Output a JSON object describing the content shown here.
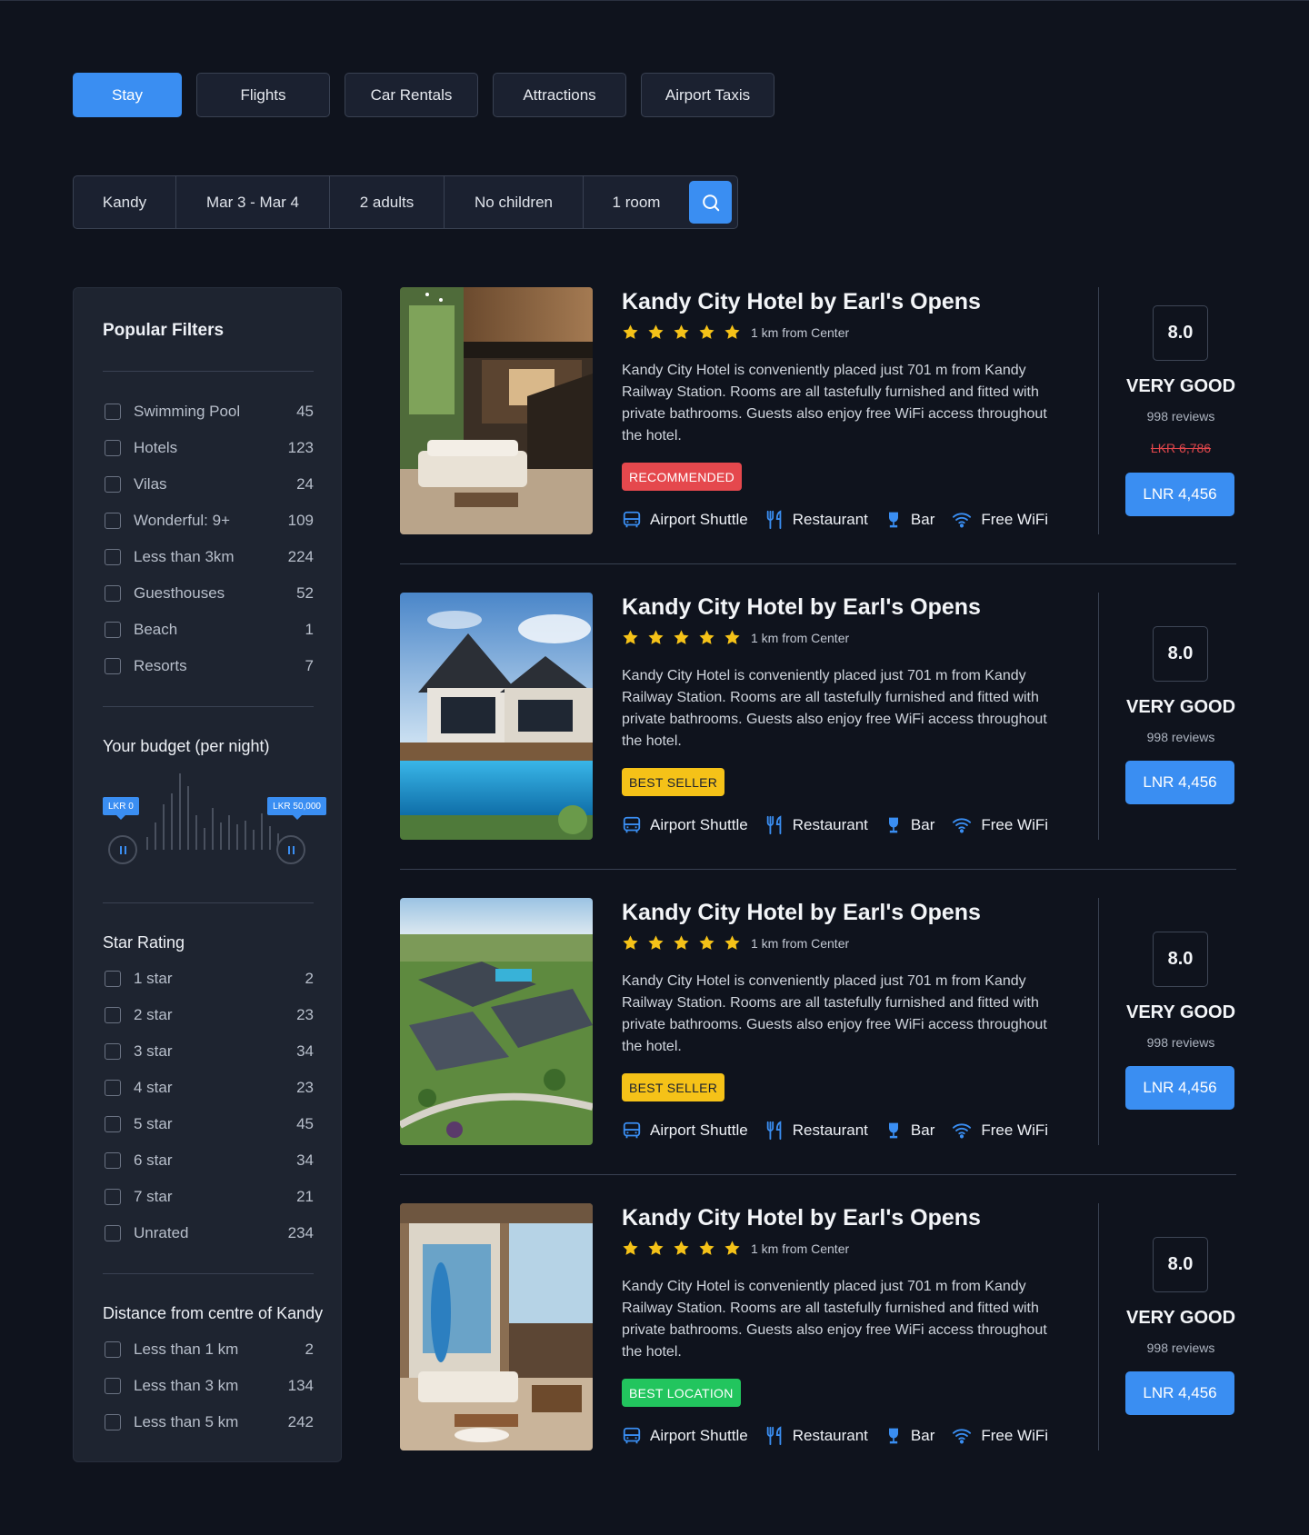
{
  "tabs": [
    "Stay",
    "Flights",
    "Car Rentals",
    "Attractions",
    "Airport Taxis"
  ],
  "active_tab": "Stay",
  "search": {
    "location": "Kandy",
    "dates": "Mar 3 - Mar 4",
    "adults": "2 adults",
    "children": "No children",
    "rooms": "1 room",
    "icon": "search-icon"
  },
  "sidebar": {
    "popular_title": "Popular Filters",
    "popular": [
      {
        "label": "Swimming Pool",
        "count": "45"
      },
      {
        "label": "Hotels",
        "count": "123"
      },
      {
        "label": "Vilas",
        "count": "24"
      },
      {
        "label": "Wonderful: 9+",
        "count": "109"
      },
      {
        "label": "Less than 3km",
        "count": "224"
      },
      {
        "label": "Guesthouses",
        "count": "52"
      },
      {
        "label": "Beach",
        "count": "1"
      },
      {
        "label": "Resorts",
        "count": "7"
      }
    ],
    "budget_title": "Your budget (per night)",
    "budget_min": "LKR 0",
    "budget_max": "LKR 50,000",
    "star_title": "Star Rating",
    "stars": [
      {
        "label": "1 star",
        "count": "2"
      },
      {
        "label": "2 star",
        "count": "23"
      },
      {
        "label": "3 star",
        "count": "34"
      },
      {
        "label": "4 star",
        "count": "23"
      },
      {
        "label": "5 star",
        "count": "45"
      },
      {
        "label": "6 star",
        "count": "34"
      },
      {
        "label": "7 star",
        "count": "21"
      },
      {
        "label": "Unrated",
        "count": "234"
      }
    ],
    "distance_title": "Distance from centre of Kandy",
    "distance": [
      {
        "label": "Less than 1 km",
        "count": "2"
      },
      {
        "label": "Less than 3 km",
        "count": "134"
      },
      {
        "label": "Less than 5 km",
        "count": "242"
      }
    ]
  },
  "hotels": [
    {
      "name": "Kandy City Hotel by Earl's Opens",
      "distance": "1 km from Center",
      "stars": 5,
      "description": "Kandy City Hotel is conveniently placed just 701 m from Kandy Railway Station. Rooms are all tastefully furnished and fitted with private bathrooms. Guests also enjoy free WiFi access throughout the hotel.",
      "badge": "RECOMMENDED",
      "badge_color": "#e5484d",
      "amenities": [
        "Airport Shuttle",
        "Restaurant",
        "Bar",
        "Free WiFi"
      ],
      "score": "8.0",
      "verdict": "VERY GOOD",
      "reviews": "998 reviews",
      "old_price": "LKR 6,786",
      "price": "LNR 4,456"
    },
    {
      "name": "Kandy City Hotel by Earl's Opens",
      "distance": "1 km from Center",
      "stars": 5,
      "description": "Kandy City Hotel is conveniently placed just 701 m from Kandy Railway Station. Rooms are all tastefully furnished and fitted with private bathrooms. Guests also enjoy free WiFi access throughout the hotel.",
      "badge": "BEST SELLER",
      "badge_color": "#f5c218",
      "amenities": [
        "Airport Shuttle",
        "Restaurant",
        "Bar",
        "Free WiFi"
      ],
      "score": "8.0",
      "verdict": "VERY GOOD",
      "reviews": "998 reviews",
      "price": "LNR 4,456"
    },
    {
      "name": "Kandy City Hotel by Earl's Opens",
      "distance": "1 km from Center",
      "stars": 5,
      "description": "Kandy City Hotel is conveniently placed just 701 m from Kandy Railway Station. Rooms are all tastefully furnished and fitted with private bathrooms. Guests also enjoy free WiFi access throughout the hotel.",
      "badge": "BEST SELLER",
      "badge_color": "#f5c218",
      "amenities": [
        "Airport Shuttle",
        "Restaurant",
        "Bar",
        "Free WiFi"
      ],
      "score": "8.0",
      "verdict": "VERY GOOD",
      "reviews": "998 reviews",
      "price": "LNR 4,456"
    },
    {
      "name": "Kandy City Hotel by Earl's Opens",
      "distance": "1 km from Center",
      "stars": 5,
      "description": "Kandy City Hotel is conveniently placed just 701 m from Kandy Railway Station. Rooms are all tastefully furnished and fitted with private bathrooms. Guests also enjoy free WiFi access throughout the hotel.",
      "badge": "BEST LOCATION",
      "badge_color": "#22c55e",
      "amenities": [
        "Airport Shuttle",
        "Restaurant",
        "Bar",
        "Free WiFi"
      ],
      "score": "8.0",
      "verdict": "VERY GOOD",
      "reviews": "998 reviews",
      "price": "LNR 4,456"
    }
  ],
  "colors": {
    "accent": "#3a8ef2",
    "background": "#0f131d",
    "panel": "#1e2430",
    "star": "#f5c218"
  }
}
